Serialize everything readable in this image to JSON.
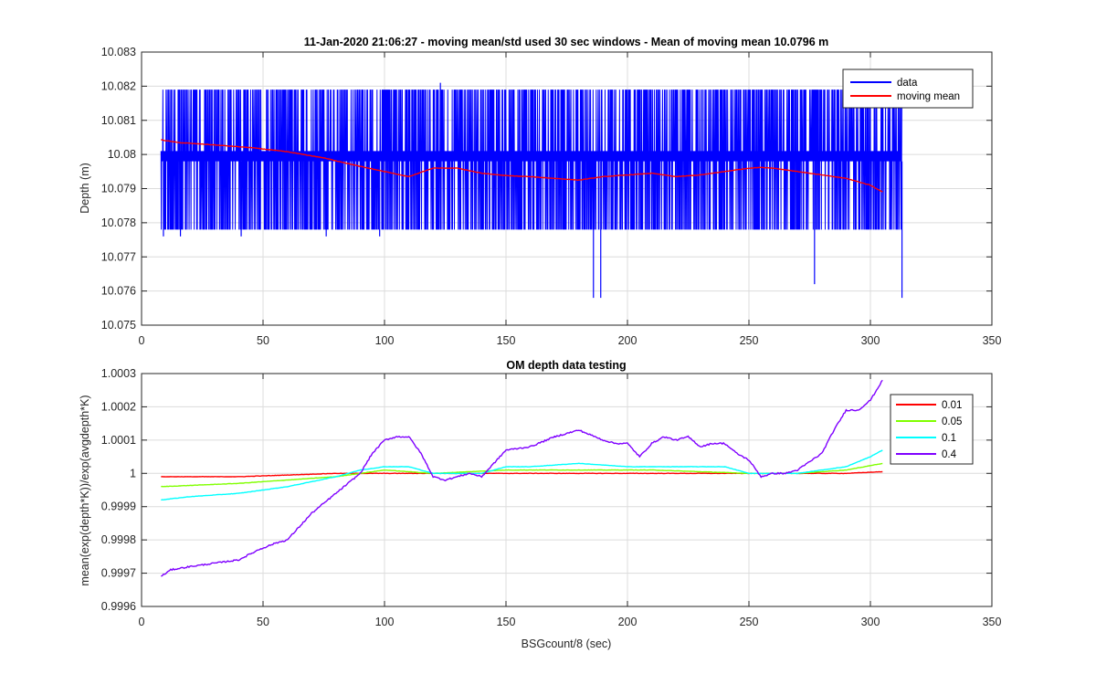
{
  "chart_data": [
    {
      "type": "line",
      "title": "11-Jan-2020 21:06:27 - moving mean/std used 30 sec windows - Mean of moving mean 10.0796 m",
      "xlabel": "",
      "ylabel": "Depth (m)",
      "xlim": [
        0,
        350
      ],
      "ylim": [
        10.075,
        10.083
      ],
      "xticks": [
        "0",
        "50",
        "100",
        "150",
        "200",
        "250",
        "300",
        "350"
      ],
      "yticks": [
        "10.075",
        "10.076",
        "10.077",
        "10.078",
        "10.079",
        "10.08",
        "10.081",
        "10.082",
        "10.083"
      ],
      "grid": true,
      "legend_position": "top-right",
      "series": [
        {
          "name": "data",
          "color": "#0000ff",
          "description_range": [
            8,
            313
          ],
          "upper_levels": [
            10.0819,
            10.0801
          ],
          "lower_levels": [
            10.0798,
            10.0778
          ],
          "spikes": [
            {
              "x": 9,
              "y": 10.0776
            },
            {
              "x": 16,
              "y": 10.0776
            },
            {
              "x": 41,
              "y": 10.0776
            },
            {
              "x": 76,
              "y": 10.0776
            },
            {
              "x": 98,
              "y": 10.0776
            },
            {
              "x": 123,
              "y": 10.0821
            },
            {
              "x": 186,
              "y": 10.0758
            },
            {
              "x": 189,
              "y": 10.0758
            },
            {
              "x": 277,
              "y": 10.0762
            },
            {
              "x": 313,
              "y": 10.0758
            }
          ]
        },
        {
          "name": "moving mean",
          "color": "#ff0000",
          "x": [
            8,
            15,
            30,
            45,
            60,
            75,
            90,
            100,
            110,
            120,
            130,
            140,
            150,
            160,
            170,
            180,
            190,
            200,
            210,
            220,
            230,
            240,
            250,
            255,
            260,
            270,
            280,
            290,
            300,
            305
          ],
          "y": [
            10.08043,
            10.08035,
            10.08028,
            10.0802,
            10.08008,
            10.0799,
            10.07965,
            10.0795,
            10.07935,
            10.0796,
            10.0796,
            10.07945,
            10.07938,
            10.07935,
            10.0793,
            10.07925,
            10.07935,
            10.0794,
            10.07945,
            10.07935,
            10.0794,
            10.0795,
            10.0796,
            10.07962,
            10.0796,
            10.0795,
            10.0794,
            10.0793,
            10.0791,
            10.0789
          ]
        }
      ]
    },
    {
      "type": "line",
      "title": "OM depth data testing",
      "xlabel": "BSGcount/8 (sec)",
      "ylabel": "mean(exp(depth*K))/exp(avgdepth*K)",
      "xlim": [
        0,
        350
      ],
      "ylim": [
        0.9996,
        1.0003
      ],
      "xticks": [
        "0",
        "50",
        "100",
        "150",
        "200",
        "250",
        "300",
        "350"
      ],
      "yticks": [
        "0.9996",
        "0.9997",
        "0.9998",
        "0.9999",
        "1",
        "1.0001",
        "1.0002",
        "1.0003"
      ],
      "grid": true,
      "legend_position": "top-right",
      "series": [
        {
          "name": "0.01",
          "color": "#ff0000",
          "x": [
            8,
            40,
            80,
            90,
            120,
            150,
            180,
            210,
            250,
            260,
            290,
            305
          ],
          "y": [
            0.99999,
            0.99999,
            1.0,
            1.0,
            1.0,
            1.0,
            1.0,
            1.0,
            1.0,
            1.0,
            1.0,
            1.000005
          ]
        },
        {
          "name": "0.05",
          "color": "#80ff00",
          "x": [
            8,
            40,
            80,
            90,
            100,
            120,
            150,
            180,
            210,
            250,
            255,
            270,
            290,
            305
          ],
          "y": [
            0.99996,
            0.99997,
            0.99999,
            1.0,
            1.00001,
            1.0,
            1.00001,
            1.00001,
            1.00001,
            1.0,
            1.0,
            1.0,
            1.00001,
            1.00003
          ]
        },
        {
          "name": "0.1",
          "color": "#00ffff",
          "x": [
            8,
            20,
            40,
            60,
            80,
            90,
            100,
            110,
            120,
            130,
            140,
            150,
            160,
            180,
            200,
            220,
            240,
            250,
            255,
            270,
            280,
            290,
            300,
            305
          ],
          "y": [
            0.99992,
            0.99993,
            0.99994,
            0.99996,
            0.99999,
            1.00001,
            1.00002,
            1.00002,
            1.0,
            1.0,
            1.0,
            1.00002,
            1.00002,
            1.00003,
            1.00002,
            1.00002,
            1.00002,
            1.0,
            1.0,
            1.0,
            1.00001,
            1.00002,
            1.00005,
            1.00007
          ]
        },
        {
          "name": "0.4",
          "color": "#7f00ff",
          "x": [
            8,
            12,
            20,
            30,
            40,
            48,
            55,
            60,
            65,
            70,
            80,
            90,
            95,
            100,
            105,
            110,
            115,
            120,
            125,
            130,
            135,
            140,
            145,
            150,
            160,
            170,
            180,
            190,
            195,
            200,
            205,
            210,
            215,
            220,
            225,
            230,
            235,
            240,
            245,
            250,
            255,
            260,
            265,
            270,
            280,
            285,
            290,
            295,
            300,
            305
          ],
          "y": [
            0.99969,
            0.99971,
            0.99972,
            0.99973,
            0.99974,
            0.99977,
            0.99979,
            0.9998,
            0.99984,
            0.99988,
            0.99994,
            1.0,
            1.00006,
            1.0001,
            1.00011,
            1.00011,
            1.00006,
            0.99999,
            0.99998,
            0.99999,
            1.0,
            0.99999,
            1.00003,
            1.00007,
            1.00008,
            1.00011,
            1.00013,
            1.0001,
            1.00009,
            1.00009,
            1.00005,
            1.00009,
            1.00011,
            1.0001,
            1.00011,
            1.00008,
            1.00009,
            1.00009,
            1.00006,
            1.00004,
            0.99999,
            1.0,
            1.0,
            1.00001,
            1.00006,
            1.00013,
            1.00019,
            1.00019,
            1.00022,
            1.00028
          ]
        }
      ]
    }
  ]
}
